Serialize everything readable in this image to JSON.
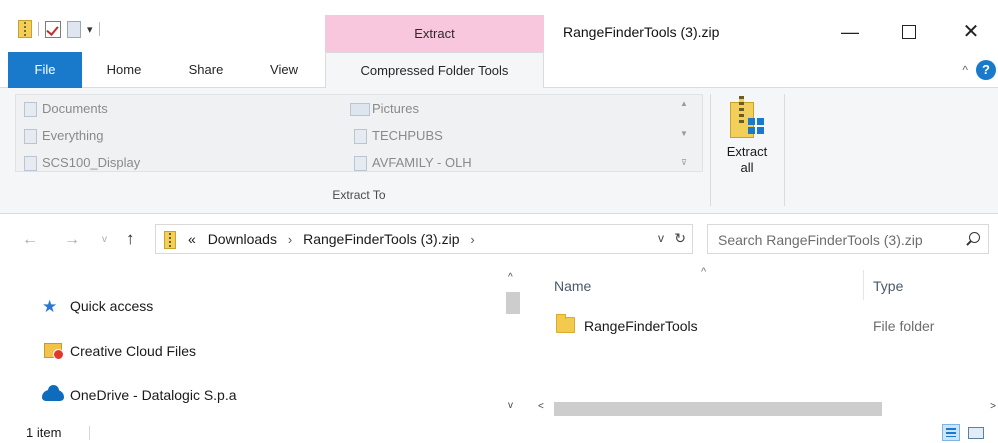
{
  "titlebar": {
    "qat_dropdown_glyph": "▾",
    "context_tab_group": "Extract",
    "window_title": "RangeFinderTools (3).zip",
    "minimize_glyph": "—",
    "close_glyph": "✕"
  },
  "tabs": [
    {
      "label": "File",
      "active": false
    },
    {
      "label": "Home",
      "active": false
    },
    {
      "label": "Share",
      "active": false
    },
    {
      "label": "View",
      "active": false
    },
    {
      "label": "Compressed Folder Tools",
      "active": true
    }
  ],
  "ribbon": {
    "collapse_glyph": "^",
    "help_glyph": "?",
    "gallery": [
      {
        "label": "Documents",
        "icon": "document-icon"
      },
      {
        "label": "Pictures",
        "icon": "pictures-icon"
      },
      {
        "label": "Everything",
        "icon": "folder-icon"
      },
      {
        "label": "TECHPUBS",
        "icon": "folder-icon"
      },
      {
        "label": "SCS100_Display",
        "icon": "folder-icon"
      },
      {
        "label": "AVFAMILY - OLH",
        "icon": "folder-icon"
      }
    ],
    "gallery_scroll": {
      "up": "▲",
      "more": "▼",
      "expand": "⊽"
    },
    "group_label": "Extract To",
    "extract_all_line1": "Extract",
    "extract_all_line2": "all"
  },
  "navigation": {
    "back": "←",
    "forward": "→",
    "recent": "v",
    "up": "↑",
    "breadcrumb_overflow": "«",
    "breadcrumbs": [
      "Downloads",
      "RangeFinderTools (3).zip"
    ],
    "crumb_separator": "›",
    "dropdown_glyph": "v",
    "refresh_glyph": "↻",
    "search_placeholder": "Search RangeFinderTools (3).zip"
  },
  "nav_pane": {
    "items": [
      {
        "label": "Quick access",
        "icon": "star-icon"
      },
      {
        "label": "Creative Cloud Files",
        "icon": "creative-cloud-folder-icon"
      },
      {
        "label": "OneDrive - Datalogic S.p.a",
        "icon": "cloud-icon"
      }
    ],
    "scroll_up": "^",
    "scroll_down": "v"
  },
  "file_list": {
    "columns": [
      "Name",
      "Type"
    ],
    "sort_glyph": "^",
    "rows": [
      {
        "name": "RangeFinderTools",
        "type": "File folder"
      }
    ],
    "hscroll_left": "<",
    "hscroll_right": ">"
  },
  "status": {
    "item_count": "1 item"
  },
  "colors": {
    "file_tab": "#1979ca",
    "extract_context": "#f8c7de",
    "ribbon_bg": "#f5f6f7"
  }
}
